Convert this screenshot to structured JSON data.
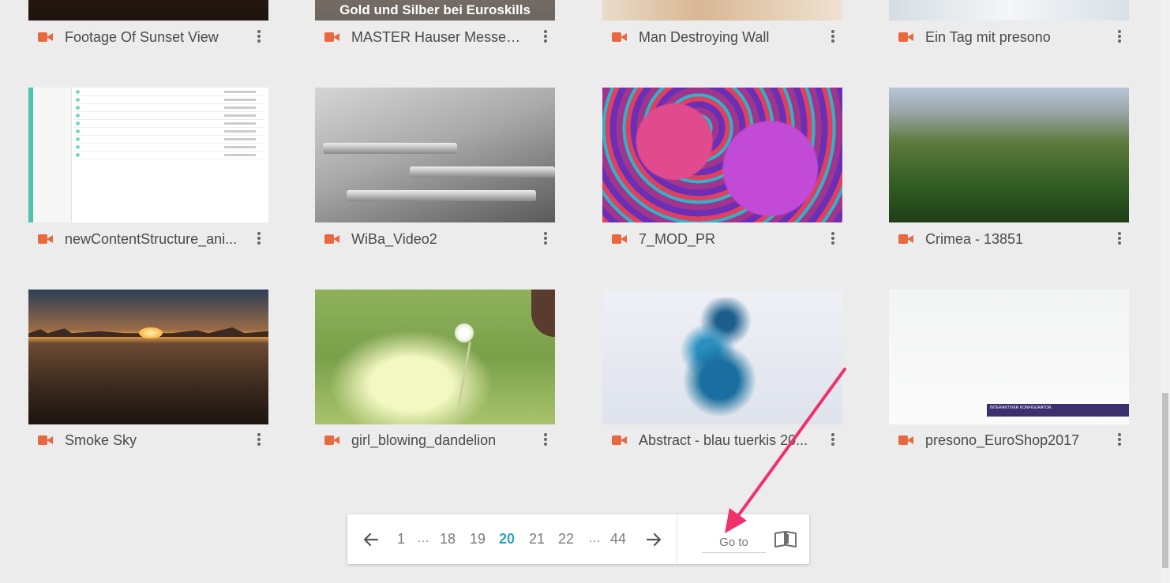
{
  "videos": [
    {
      "title": "Footage Of Sunset View"
    },
    {
      "title": "MASTER Hauser Messevid...",
      "thumb_caption": "Gold und Silber bei Euroskills"
    },
    {
      "title": "Man Destroying Wall"
    },
    {
      "title": "Ein Tag mit presono"
    },
    {
      "title": "newContentStructure_ani..."
    },
    {
      "title": "WiBa_Video2"
    },
    {
      "title": "7_MOD_PR"
    },
    {
      "title": "Crimea - 13851"
    },
    {
      "title": "Smoke Sky"
    },
    {
      "title": "girl_blowing_dandelion"
    },
    {
      "title": "Abstract - blau tuerkis 20..."
    },
    {
      "title": "presono_EuroShop2017",
      "thumb_caption": "INTERAKTIVER KONFIGURATOR"
    }
  ],
  "pagination": {
    "pages": [
      "1",
      "…",
      "18",
      "19",
      "20",
      "21",
      "22",
      "…",
      "44"
    ],
    "current": "20",
    "goto_placeholder": "Go to"
  },
  "icons": {
    "video": "video-camera-icon",
    "more": "more-vertical-icon",
    "prev": "arrow-left-icon",
    "next": "arrow-right-icon",
    "book": "open-book-icon"
  },
  "colors": {
    "accent": "#2fa4c3",
    "video_icon": "#e8683f",
    "annotation_arrow": "#f0306a"
  }
}
